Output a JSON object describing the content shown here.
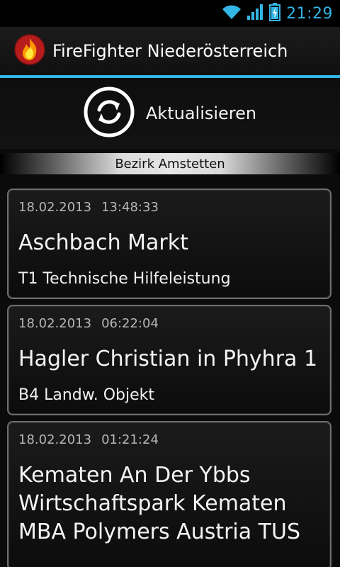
{
  "statusbar": {
    "time": "21:29",
    "icons": [
      "wifi-icon",
      "signal-icon",
      "battery-charging-icon"
    ]
  },
  "app": {
    "title": "FireFighter Niederösterreich",
    "logo": "flame-icon",
    "accent": "#33b5e5"
  },
  "refresh": {
    "label": "Aktualisieren",
    "icon": "refresh-icon"
  },
  "section": {
    "label": "Bezirk Amstetten"
  },
  "incidents": [
    {
      "date": "18.02.2013",
      "time": "13:48:33",
      "location": "Aschbach Markt",
      "type": "T1 Technische Hilfeleistung"
    },
    {
      "date": "18.02.2013",
      "time": "06:22:04",
      "location": "Hagler Christian in Phyhra 1",
      "type": "B4 Landw. Objekt"
    },
    {
      "date": "18.02.2013",
      "time": "01:21:24",
      "location": "Kematen An Der Ybbs Wirtschaftspark Kematen MBA Polymers Austria TUS",
      "type": ""
    }
  ]
}
